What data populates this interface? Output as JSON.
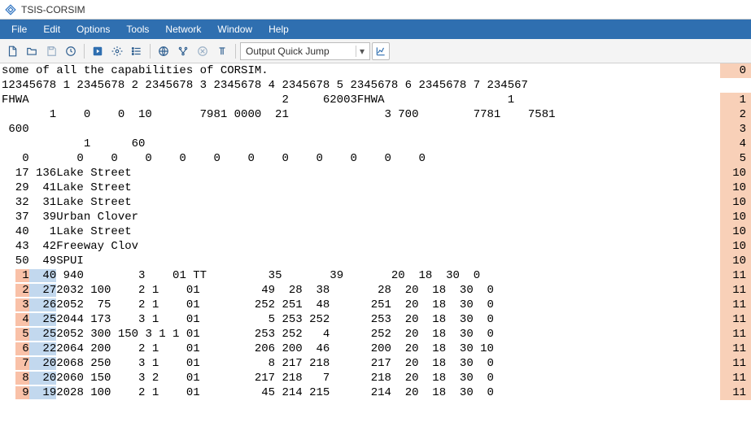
{
  "window": {
    "title": "TSIS-CORSIM"
  },
  "menu": {
    "items": [
      "File",
      "Edit",
      "Options",
      "Tools",
      "Network",
      "Window",
      "Help"
    ]
  },
  "toolbar": {
    "dropdown_label": "Output Quick Jump"
  },
  "gutter": {
    "values": [
      "0",
      "",
      "1",
      "2",
      "3",
      "4",
      "5",
      "10",
      "10",
      "10",
      "10",
      "10",
      "10",
      "10",
      "11",
      "11",
      "11",
      "11",
      "11",
      "11",
      "11",
      "11",
      "11"
    ],
    "hl": [
      "peach",
      "",
      "peach",
      "peach",
      "peach",
      "peach",
      "peach",
      "peach",
      "peach",
      "peach",
      "peach",
      "peach",
      "peach",
      "peach",
      "peach",
      "peach",
      "peach",
      "peach",
      "peach",
      "peach",
      "peach",
      "peach",
      "peach"
    ]
  },
  "editor": {
    "lines": [
      {
        "pre": "",
        "redcol": "",
        "bluecol": "",
        "rest": "some of all the capabilities of CORSIM."
      },
      {
        "pre": "",
        "redcol": "",
        "bluecol": "",
        "rest": "12345678 1 2345678 2 2345678 3 2345678 4 2345678 5 2345678 6 2345678 7 234567"
      },
      {
        "pre": "",
        "redcol": "",
        "bluecol": "",
        "rest": "FHWA                                     2     62003FHWA                  1"
      },
      {
        "pre": "",
        "redcol": "",
        "bluecol": "",
        "rest": "       1    0    0  10       7981 0000  21              3 700        7781    7581"
      },
      {
        "pre": "",
        "redcol": "",
        "bluecol": "",
        "rest": " 600"
      },
      {
        "pre": "",
        "redcol": "",
        "bluecol": "",
        "rest": "            1      60"
      },
      {
        "pre": "",
        "redcol": "",
        "bluecol": "",
        "rest": "   0       0    0    0    0    0    0    0    0    0    0    0"
      },
      {
        "pre": "",
        "redcol": "",
        "bluecol": "",
        "rest": "  17 136Lake Street"
      },
      {
        "pre": "",
        "redcol": "",
        "bluecol": "",
        "rest": "  29  41Lake Street"
      },
      {
        "pre": "",
        "redcol": "",
        "bluecol": "",
        "rest": "  32  31Lake Street"
      },
      {
        "pre": "",
        "redcol": "",
        "bluecol": "",
        "rest": "  37  39Urban Clover"
      },
      {
        "pre": "",
        "redcol": "",
        "bluecol": "",
        "rest": "  40   1Lake Street"
      },
      {
        "pre": "",
        "redcol": "",
        "bluecol": "",
        "rest": "  43  42Freeway Clov"
      },
      {
        "pre": "",
        "redcol": "",
        "bluecol": "",
        "rest": "  50  49SPUI"
      },
      {
        "pre": "  ",
        "redcol": " 1",
        "bluecol": "  40",
        "rest": " 940        3    01 TT         35       39       20  18  30  0"
      },
      {
        "pre": "  ",
        "redcol": " 2",
        "bluecol": "  27",
        "rest": "2032 100    2 1    01         49  28  38       28  20  18  30  0"
      },
      {
        "pre": "  ",
        "redcol": " 3",
        "bluecol": "  26",
        "rest": "2052  75    2 1    01        252 251  48      251  20  18  30  0"
      },
      {
        "pre": "  ",
        "redcol": " 4",
        "bluecol": "  25",
        "rest": "2044 173    3 1    01          5 253 252      253  20  18  30  0"
      },
      {
        "pre": "  ",
        "redcol": " 5",
        "bluecol": "  25",
        "rest": "2052 300 150 3 1 1 01        253 252   4      252  20  18  30  0"
      },
      {
        "pre": "  ",
        "redcol": " 6",
        "bluecol": "  22",
        "rest": "2064 200    2 1    01        206 200  46      200  20  18  30 10"
      },
      {
        "pre": "  ",
        "redcol": " 7",
        "bluecol": "  20",
        "rest": "2068 250    3 1    01          8 217 218      217  20  18  30  0"
      },
      {
        "pre": "  ",
        "redcol": " 8",
        "bluecol": "  20",
        "rest": "2060 150    3 2    01        217 218   7      218  20  18  30  0"
      },
      {
        "pre": "  ",
        "redcol": " 9",
        "bluecol": "  19",
        "rest": "2028 100    2 1    01         45 214 215      214  20  18  30  0"
      }
    ]
  }
}
